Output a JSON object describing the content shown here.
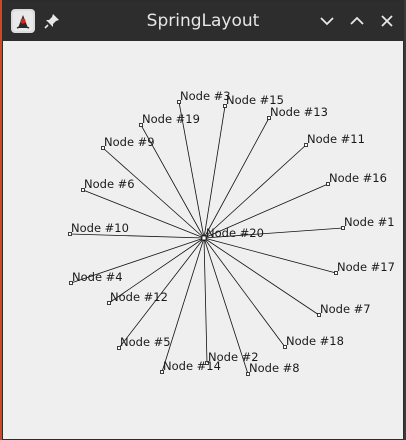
{
  "window": {
    "title": "SpringLayout"
  },
  "titlebar": {
    "app_icon": "java-duke-icon",
    "pin_icon": "pin-icon",
    "minimize_icon": "chevron-down-icon",
    "maximize_icon": "chevron-up-icon",
    "close_icon": "close-icon"
  },
  "colors": {
    "titlebar": "#2d2d2d",
    "canvas": "#efefef",
    "edge": "#111111"
  },
  "graph": {
    "center": {
      "label": "Node #20"
    },
    "nodes": [
      {
        "label": "Node #3"
      },
      {
        "label": "Node #15"
      },
      {
        "label": "Node #13"
      },
      {
        "label": "Node #19"
      },
      {
        "label": "Node #9"
      },
      {
        "label": "Node #11"
      },
      {
        "label": "Node #6"
      },
      {
        "label": "Node #16"
      },
      {
        "label": "Node #10"
      },
      {
        "label": "Node #1"
      },
      {
        "label": "Node #17"
      },
      {
        "label": "Node #4"
      },
      {
        "label": "Node #12"
      },
      {
        "label": "Node #7"
      },
      {
        "label": "Node #18"
      },
      {
        "label": "Node #5"
      },
      {
        "label": "Node #2"
      },
      {
        "label": "Node #14"
      },
      {
        "label": "Node #8"
      }
    ]
  }
}
